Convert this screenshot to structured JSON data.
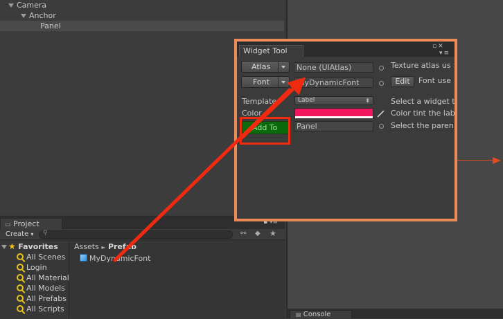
{
  "hierarchy": {
    "items": [
      {
        "label": "Camera"
      },
      {
        "label": "Anchor"
      },
      {
        "label": "Panel"
      }
    ]
  },
  "project": {
    "tab": "Project",
    "create_label": "Create",
    "favorites_label": "Favorites",
    "favorites": [
      "All Scenes",
      "Login",
      "All Material",
      "All Models",
      "All Prefabs",
      "All Scripts"
    ],
    "breadcrumb": {
      "root": "Assets",
      "sep": "►",
      "current": "Prefab"
    },
    "assets": [
      "MyDynamicFont"
    ]
  },
  "console": {
    "tab": "Console"
  },
  "widget_tool": {
    "title": "Widget Tool",
    "atlas_label": "Atlas",
    "atlas_value": "None (UIAtlas)",
    "atlas_desc": "Texture atlas us",
    "font_label": "Font",
    "font_value": "MyDynamicFont",
    "font_edit": "Edit",
    "font_desc": "Font use",
    "template_label": "Template",
    "template_value": "Label",
    "template_desc": "Select a widget t",
    "color_label": "Color",
    "color_value": "#f0175e",
    "color_desc": "Color tint the lab",
    "add_to_label": "Add To",
    "add_to_value": "Panel",
    "add_to_desc": "Select the paren"
  },
  "colors": {
    "annotation": "#f02a10",
    "window_outline": "#ec8a5a",
    "add_button": "#0b6a0b",
    "axis_arrow": "#e04a20"
  }
}
